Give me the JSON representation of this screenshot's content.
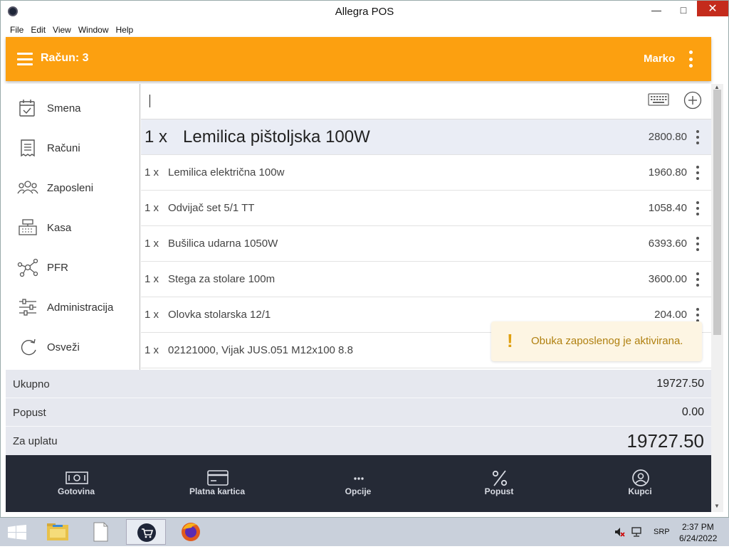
{
  "window": {
    "title": "Allegra POS",
    "min_label": "—",
    "max_label": "□",
    "close_label": "✕"
  },
  "menu": [
    "File",
    "Edit",
    "View",
    "Window",
    "Help"
  ],
  "header": {
    "title": "Račun: 3",
    "user": "Marko",
    "accent": "#fca010"
  },
  "sidebar": {
    "items": [
      {
        "label": "Smena",
        "icon": "calendar-check-icon"
      },
      {
        "label": "Računi",
        "icon": "receipt-icon"
      },
      {
        "label": "Zaposleni",
        "icon": "people-icon"
      },
      {
        "label": "Kasa",
        "icon": "cash-register-icon"
      },
      {
        "label": "PFR",
        "icon": "network-nodes-icon"
      },
      {
        "label": "Administracija",
        "icon": "sliders-icon"
      },
      {
        "label": "Osveži",
        "icon": "refresh-icon"
      }
    ]
  },
  "search": {
    "value": ""
  },
  "items": [
    {
      "qty": "1 x",
      "name": "Lemilica pištoljska 100W",
      "price": "2800.80",
      "selected": true
    },
    {
      "qty": "1 x",
      "name": "Lemilica električna 100w",
      "price": "1960.80"
    },
    {
      "qty": "1 x",
      "name": "Odvijač set 5/1 TT",
      "price": "1058.40"
    },
    {
      "qty": "1 x",
      "name": "Bušilica udarna 1050W",
      "price": "6393.60"
    },
    {
      "qty": "1 x",
      "name": "Stega za stolare 100m",
      "price": "3600.00"
    },
    {
      "qty": "1 x",
      "name": "Olovka stolarska 12/1",
      "price": "204.00"
    },
    {
      "qty": "1 x",
      "name": "02121000, Vijak JUS.051 M12x100 8.8",
      "price": ""
    }
  ],
  "toast": {
    "icon": "!",
    "text": "Obuka zaposlenog je aktivirana."
  },
  "totals": {
    "total_label": "Ukupno",
    "total_value": "19727.50",
    "discount_label": "Popust",
    "discount_value": "0.00",
    "pay_label": "Za uplatu",
    "pay_value": "19727.50"
  },
  "actions": [
    {
      "label": "Gotovina",
      "icon": "banknote-icon"
    },
    {
      "label": "Platna kartica",
      "icon": "credit-card-icon"
    },
    {
      "label": "Opcije",
      "icon": "more-horizontal-icon"
    },
    {
      "label": "Popust",
      "icon": "percent-icon"
    },
    {
      "label": "Kupci",
      "icon": "user-circle-icon"
    }
  ],
  "taskbar": {
    "lang": "SRP",
    "time": "2:37 PM",
    "date": "6/24/2022"
  }
}
